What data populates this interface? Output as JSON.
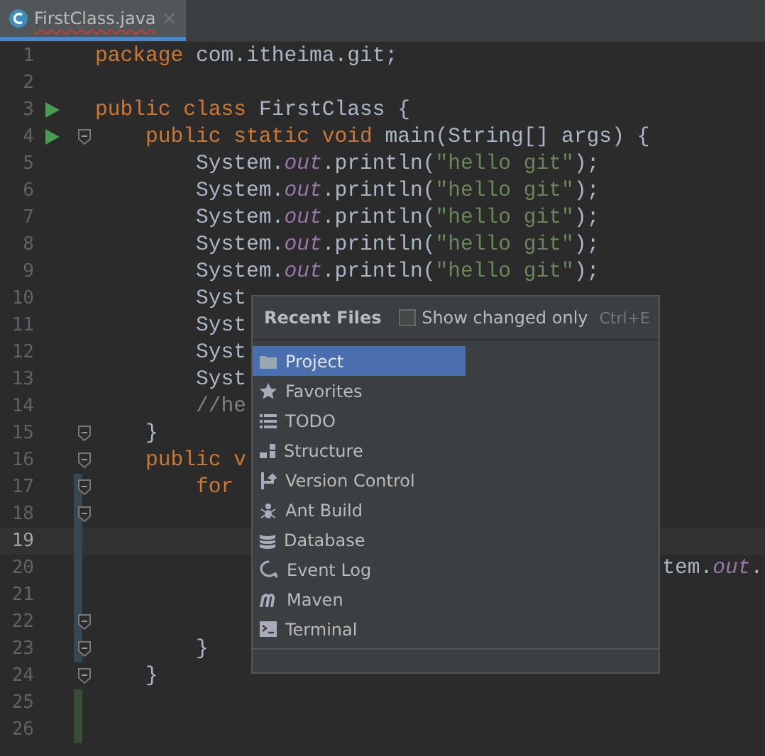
{
  "tabs": [
    {
      "label": "FirstClass.java",
      "selected": true,
      "close": "×"
    }
  ],
  "editor": {
    "lines": [
      {
        "number": "1",
        "run": false,
        "fold": false,
        "current": false,
        "tokens": [
          {
            "kind": "keyword",
            "text": "package "
          },
          {
            "kind": "plain",
            "text": "com.itheima.git;"
          }
        ]
      },
      {
        "number": "2",
        "run": false,
        "fold": false,
        "current": false
      },
      {
        "number": "3",
        "run": true,
        "fold": false,
        "current": false,
        "tokens": [
          {
            "kind": "keyword",
            "text": "public class "
          },
          {
            "kind": "plain",
            "text": "FirstClass {"
          }
        ]
      },
      {
        "number": "4",
        "run": true,
        "fold": true,
        "current": false,
        "tokens": [
          {
            "kind": "keyword",
            "text": "    public static void "
          },
          {
            "kind": "plain",
            "text": "main(String[] args) {"
          }
        ]
      },
      {
        "number": "5",
        "run": false,
        "fold": false,
        "current": false,
        "tokens": [
          {
            "kind": "plain",
            "text": "        System."
          },
          {
            "kind": "field",
            "text": "out"
          },
          {
            "kind": "plain",
            "text": ".println("
          },
          {
            "kind": "string",
            "text": "\"hello git\""
          },
          {
            "kind": "plain",
            "text": ");"
          }
        ]
      },
      {
        "number": "6",
        "run": false,
        "fold": false,
        "current": false,
        "tokens": [
          {
            "kind": "plain",
            "text": "        System."
          },
          {
            "kind": "field",
            "text": "out"
          },
          {
            "kind": "plain",
            "text": ".println("
          },
          {
            "kind": "string",
            "text": "\"hello git\""
          },
          {
            "kind": "plain",
            "text": ");"
          }
        ]
      },
      {
        "number": "7",
        "run": false,
        "fold": false,
        "current": false,
        "tokens": [
          {
            "kind": "plain",
            "text": "        System."
          },
          {
            "kind": "field",
            "text": "out"
          },
          {
            "kind": "plain",
            "text": ".println("
          },
          {
            "kind": "string",
            "text": "\"hello git\""
          },
          {
            "kind": "plain",
            "text": ");"
          }
        ]
      },
      {
        "number": "8",
        "run": false,
        "fold": false,
        "current": false,
        "tokens": [
          {
            "kind": "plain",
            "text": "        System."
          },
          {
            "kind": "field",
            "text": "out"
          },
          {
            "kind": "plain",
            "text": ".println("
          },
          {
            "kind": "string",
            "text": "\"hello git\""
          },
          {
            "kind": "plain",
            "text": ");"
          }
        ]
      },
      {
        "number": "9",
        "run": false,
        "fold": false,
        "current": false,
        "tokens": [
          {
            "kind": "plain",
            "text": "        System."
          },
          {
            "kind": "field",
            "text": "out"
          },
          {
            "kind": "plain",
            "text": ".println("
          },
          {
            "kind": "string",
            "text": "\"hello git\""
          },
          {
            "kind": "plain",
            "text": ");"
          }
        ]
      },
      {
        "number": "10",
        "run": false,
        "fold": false,
        "current": false,
        "tokens": [
          {
            "kind": "plain",
            "text": "        Syst"
          }
        ]
      },
      {
        "number": "11",
        "run": false,
        "fold": false,
        "current": false,
        "tokens": [
          {
            "kind": "plain",
            "text": "        Syst"
          }
        ]
      },
      {
        "number": "12",
        "run": false,
        "fold": false,
        "current": false,
        "tokens": [
          {
            "kind": "plain",
            "text": "        Syst"
          }
        ]
      },
      {
        "number": "13",
        "run": false,
        "fold": false,
        "current": false,
        "tokens": [
          {
            "kind": "plain",
            "text": "        Syst"
          }
        ]
      },
      {
        "number": "14",
        "run": false,
        "fold": false,
        "current": false,
        "tokens": [
          {
            "kind": "comment",
            "text": "        //he"
          }
        ]
      },
      {
        "number": "15",
        "run": false,
        "fold": true,
        "current": false,
        "tokens": [
          {
            "kind": "plain",
            "text": "    }"
          }
        ]
      },
      {
        "number": "16",
        "run": false,
        "fold": true,
        "current": false,
        "tokens": [
          {
            "kind": "keyword",
            "text": "    public v"
          }
        ]
      },
      {
        "number": "17",
        "run": false,
        "fold": true,
        "modified": true,
        "current": false,
        "tokens": [
          {
            "kind": "keyword",
            "text": "        for"
          }
        ]
      },
      {
        "number": "18",
        "run": false,
        "fold": true,
        "modified": true,
        "current": false
      },
      {
        "number": "19",
        "run": false,
        "fold": false,
        "modified": true,
        "current": true
      },
      {
        "number": "20",
        "run": false,
        "fold": false,
        "modified": true,
        "current": false,
        "tokens": [
          {
            "kind": "plain",
            "text": "                                             tem."
          },
          {
            "kind": "field",
            "text": "out"
          },
          {
            "kind": "plain",
            "text": "."
          }
        ]
      },
      {
        "number": "21",
        "run": false,
        "fold": false,
        "modified": true,
        "current": false
      },
      {
        "number": "22",
        "run": false,
        "fold": true,
        "modified": true,
        "current": false
      },
      {
        "number": "23",
        "run": false,
        "fold": true,
        "modified": true,
        "current": false,
        "tokens": [
          {
            "kind": "plain",
            "text": "        }"
          }
        ]
      },
      {
        "number": "24",
        "run": false,
        "fold": true,
        "current": false,
        "tokens": [
          {
            "kind": "plain",
            "text": "    }"
          }
        ]
      },
      {
        "number": "25",
        "run": false,
        "fold": false,
        "added": true,
        "current": false
      },
      {
        "number": "26",
        "run": false,
        "fold": false,
        "added": true,
        "current": false
      }
    ]
  },
  "popup": {
    "title": "Recent Files",
    "checkbox": {
      "label": "Show changed only",
      "checked": false,
      "shortcut": "Ctrl+E"
    },
    "items": [
      {
        "kind": "project",
        "label": "Project",
        "selected": true
      },
      {
        "kind": "favorites",
        "label": "Favorites",
        "selected": false
      },
      {
        "kind": "todo",
        "label": "TODO",
        "selected": false
      },
      {
        "kind": "structure",
        "label": "Structure",
        "selected": false
      },
      {
        "kind": "vcs",
        "label": "Version Control",
        "selected": false
      },
      {
        "kind": "ant",
        "label": "Ant Build",
        "selected": false
      },
      {
        "kind": "database",
        "label": "Database",
        "selected": false
      },
      {
        "kind": "eventlog",
        "label": "Event Log",
        "selected": false
      },
      {
        "kind": "maven",
        "label": "Maven",
        "selected": false
      },
      {
        "kind": "terminal",
        "label": "Terminal",
        "selected": false
      }
    ]
  }
}
